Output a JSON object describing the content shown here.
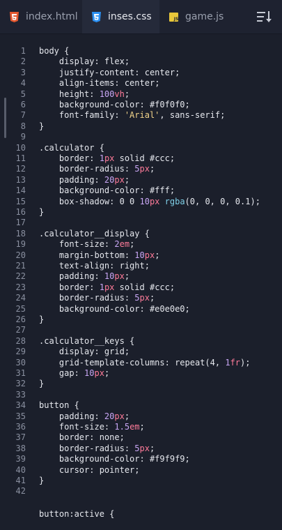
{
  "tabs": [
    {
      "label": "index.html",
      "icon": "html5-icon",
      "color": "#e4572e",
      "active": false
    },
    {
      "label": "inses.css",
      "icon": "css3-icon",
      "color": "#2a8ff1",
      "active": true
    },
    {
      "label": "game.js",
      "icon": "javascript-icon",
      "color": "#e9c73a",
      "active": false
    }
  ],
  "sort_icon": "sort-lines-icon",
  "lines": [
    {
      "n": "1",
      "t": [
        [
          "sel",
          "body "
        ],
        [
          "punc",
          "{"
        ]
      ]
    },
    {
      "n": "2",
      "t": [
        [
          "prop",
          "    display: "
        ],
        [
          "val",
          "flex"
        ],
        [
          "punc",
          ";"
        ]
      ]
    },
    {
      "n": "3",
      "t": [
        [
          "prop",
          "    justify-content: "
        ],
        [
          "val",
          "center"
        ],
        [
          "punc",
          ";"
        ]
      ]
    },
    {
      "n": "4",
      "t": [
        [
          "prop",
          "    align-items: "
        ],
        [
          "val",
          "center"
        ],
        [
          "punc",
          ";"
        ]
      ]
    },
    {
      "n": "5",
      "t": [
        [
          "prop",
          "    height: "
        ],
        [
          "num",
          "100"
        ],
        [
          "unit",
          "vh"
        ],
        [
          "punc",
          ";"
        ]
      ]
    },
    {
      "n": "6",
      "t": [
        [
          "prop",
          "    background-color: "
        ],
        [
          "val",
          "#f0f0f0"
        ],
        [
          "punc",
          ";"
        ]
      ]
    },
    {
      "n": "7",
      "t": [
        [
          "prop",
          "    font-family: "
        ],
        [
          "str",
          "'Arial'"
        ],
        [
          "punc",
          ", "
        ],
        [
          "val",
          "sans-serif"
        ],
        [
          "punc",
          ";"
        ]
      ]
    },
    {
      "n": "8",
      "t": [
        [
          "punc",
          "}"
        ]
      ]
    },
    {
      "n": "9",
      "t": []
    },
    {
      "n": "10",
      "t": [
        [
          "sel",
          ".calculator "
        ],
        [
          "punc",
          "{"
        ]
      ]
    },
    {
      "n": "11",
      "t": [
        [
          "prop",
          "    border: "
        ],
        [
          "num",
          "1"
        ],
        [
          "unit",
          "px"
        ],
        [
          "val",
          " solid #ccc"
        ],
        [
          "punc",
          ";"
        ]
      ]
    },
    {
      "n": "12",
      "t": [
        [
          "prop",
          "    border-radius: "
        ],
        [
          "num",
          "5"
        ],
        [
          "unit",
          "px"
        ],
        [
          "punc",
          ";"
        ]
      ]
    },
    {
      "n": "13",
      "t": [
        [
          "prop",
          "    padding: "
        ],
        [
          "num",
          "20"
        ],
        [
          "unit",
          "px"
        ],
        [
          "punc",
          ";"
        ]
      ]
    },
    {
      "n": "14",
      "t": [
        [
          "prop",
          "    background-color: "
        ],
        [
          "val",
          "#fff"
        ],
        [
          "punc",
          ";"
        ]
      ]
    },
    {
      "n": "15",
      "t": [
        [
          "prop",
          "    box-shadow: "
        ],
        [
          "val",
          "0 0 "
        ],
        [
          "num",
          "10"
        ],
        [
          "unit",
          "px"
        ],
        [
          "val",
          " "
        ],
        [
          "fn",
          "rgba"
        ],
        [
          "punc",
          "("
        ],
        [
          "val",
          "0, 0, 0, 0.1"
        ],
        [
          "punc",
          ");"
        ]
      ]
    },
    {
      "n": "16",
      "t": [
        [
          "punc",
          "}"
        ]
      ]
    },
    {
      "n": "17",
      "t": []
    },
    {
      "n": "18",
      "t": [
        [
          "sel",
          ".calculator__display "
        ],
        [
          "punc",
          "{"
        ]
      ]
    },
    {
      "n": "19",
      "t": [
        [
          "prop",
          "    font-size: "
        ],
        [
          "num",
          "2"
        ],
        [
          "unit",
          "em"
        ],
        [
          "punc",
          ";"
        ]
      ]
    },
    {
      "n": "20",
      "t": [
        [
          "prop",
          "    margin-bottom: "
        ],
        [
          "num",
          "10"
        ],
        [
          "unit",
          "px"
        ],
        [
          "punc",
          ";"
        ]
      ]
    },
    {
      "n": "21",
      "t": [
        [
          "prop",
          "    text-align: "
        ],
        [
          "val",
          "right"
        ],
        [
          "punc",
          ";"
        ]
      ]
    },
    {
      "n": "22",
      "t": [
        [
          "prop",
          "    padding: "
        ],
        [
          "num",
          "10"
        ],
        [
          "unit",
          "px"
        ],
        [
          "punc",
          ";"
        ]
      ]
    },
    {
      "n": "23",
      "t": [
        [
          "prop",
          "    border: "
        ],
        [
          "num",
          "1"
        ],
        [
          "unit",
          "px"
        ],
        [
          "val",
          " solid #ccc"
        ],
        [
          "punc",
          ";"
        ]
      ]
    },
    {
      "n": "24",
      "t": [
        [
          "prop",
          "    border-radius: "
        ],
        [
          "num",
          "5"
        ],
        [
          "unit",
          "px"
        ],
        [
          "punc",
          ";"
        ]
      ]
    },
    {
      "n": "25",
      "t": [
        [
          "prop",
          "    background-color: "
        ],
        [
          "val",
          "#e0e0e0"
        ],
        [
          "punc",
          ";"
        ]
      ]
    },
    {
      "n": "26",
      "t": [
        [
          "punc",
          "}"
        ]
      ]
    },
    {
      "n": "27",
      "t": []
    },
    {
      "n": "28",
      "t": [
        [
          "sel",
          ".calculator__keys "
        ],
        [
          "punc",
          "{"
        ]
      ]
    },
    {
      "n": "29",
      "t": [
        [
          "prop",
          "    display: "
        ],
        [
          "val",
          "grid"
        ],
        [
          "punc",
          ";"
        ]
      ]
    },
    {
      "n": "30",
      "t": [
        [
          "prop",
          "    grid-template-columns: "
        ],
        [
          "val",
          "repeat(4, "
        ],
        [
          "num",
          "1"
        ],
        [
          "unit",
          "fr"
        ],
        [
          "punc",
          ");"
        ]
      ]
    },
    {
      "n": "31",
      "t": [
        [
          "prop",
          "    gap: "
        ],
        [
          "num",
          "10"
        ],
        [
          "unit",
          "px"
        ],
        [
          "punc",
          ";"
        ]
      ]
    },
    {
      "n": "32",
      "t": [
        [
          "punc",
          "}"
        ]
      ]
    },
    {
      "n": "33",
      "t": []
    },
    {
      "n": "34",
      "t": [
        [
          "sel",
          "button "
        ],
        [
          "punc",
          "{"
        ]
      ]
    },
    {
      "n": "35",
      "t": [
        [
          "prop",
          "    padding: "
        ],
        [
          "num",
          "20"
        ],
        [
          "unit",
          "px"
        ],
        [
          "punc",
          ";"
        ]
      ]
    },
    {
      "n": "36",
      "t": [
        [
          "prop",
          "    font-size: "
        ],
        [
          "num",
          "1.5"
        ],
        [
          "unit",
          "em"
        ],
        [
          "punc",
          ";"
        ]
      ]
    },
    {
      "n": "37",
      "t": [
        [
          "prop",
          "    border: "
        ],
        [
          "val",
          "none"
        ],
        [
          "punc",
          ";"
        ]
      ]
    },
    {
      "n": "38",
      "t": [
        [
          "prop",
          "    border-radius: "
        ],
        [
          "num",
          "5"
        ],
        [
          "unit",
          "px"
        ],
        [
          "punc",
          ";"
        ]
      ]
    },
    {
      "n": "39",
      "t": [
        [
          "prop",
          "    background-color: "
        ],
        [
          "val",
          "#f9f9f9"
        ],
        [
          "punc",
          ";"
        ]
      ]
    },
    {
      "n": "40",
      "t": [
        [
          "prop",
          "    cursor: "
        ],
        [
          "val",
          "pointer"
        ],
        [
          "punc",
          ";"
        ]
      ]
    },
    {
      "n": "41",
      "t": [
        [
          "punc",
          "}"
        ]
      ]
    },
    {
      "n": "42",
      "t": []
    }
  ],
  "partial_line": "button:active {"
}
